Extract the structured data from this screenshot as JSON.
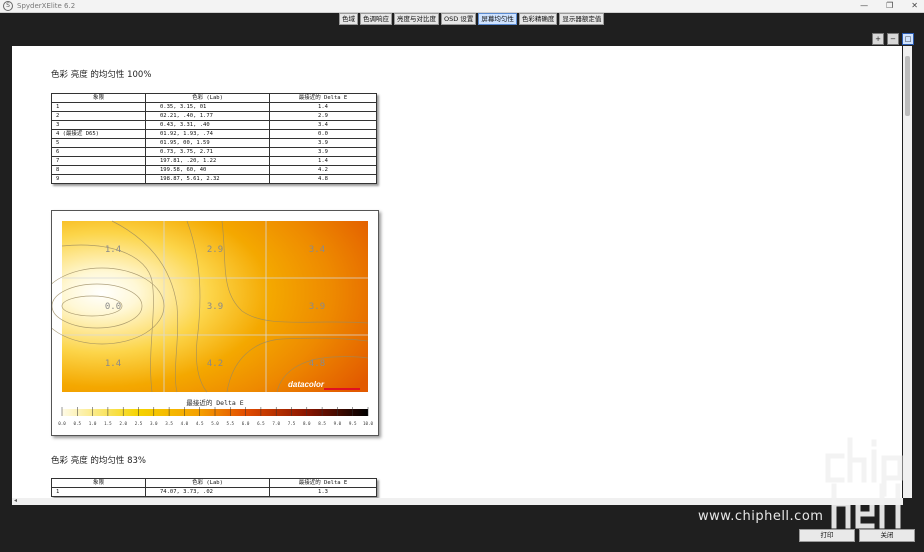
{
  "window": {
    "title": "SpyderXElite 6.2",
    "icon_label": "S"
  },
  "tabs": [
    {
      "label": "色域"
    },
    {
      "label": "色调响应"
    },
    {
      "label": "亮度与对比度"
    },
    {
      "label": "OSD 设置"
    },
    {
      "label": "屏幕均匀性",
      "active": true
    },
    {
      "label": "色彩精确度"
    },
    {
      "label": "显示器额定值"
    }
  ],
  "toolbar": {
    "icons": [
      "zoom-in-icon",
      "zoom-out-icon",
      "zoom-fit-icon"
    ]
  },
  "section1": {
    "title": "色彩 亮度 的均匀性 100%",
    "headers": [
      "象限",
      "色彩 (Lab)",
      "最接近的 Delta E"
    ],
    "rows": [
      [
        "1",
        "0.35,   3.15,    01",
        "1.4"
      ],
      [
        "2",
        "02.21,    .40,   1.77",
        "2.9"
      ],
      [
        "3",
        "0.43,   3.31,    .40",
        "3.4"
      ],
      [
        "4 (最接近 D65)",
        "01.92,   1.93,    .74",
        "0.0"
      ],
      [
        "5",
        "01.95,    00,   1.59",
        "3.9"
      ],
      [
        "6",
        "0.73,   3.75,   2.71",
        "3.9"
      ],
      [
        "7",
        "197.81,    .20,   1.22",
        "1.4"
      ],
      [
        "8",
        "199.58,    60,    40",
        "4.2"
      ],
      [
        "9",
        "198.87,   5.61,   2.32",
        "4.8"
      ]
    ]
  },
  "heatmap": {
    "cell_values": [
      "1.4",
      "2.9",
      "3.4",
      "0.0",
      "3.9",
      "3.9",
      "1.4",
      "4.2",
      "4.8"
    ],
    "brand": "datacolor",
    "legend_title": "最接近的 Delta E",
    "legend_ticks": [
      "0.0",
      "0.5",
      "1.0",
      "1.5",
      "2.0",
      "2.5",
      "3.0",
      "3.5",
      "4.0",
      "4.5",
      "5.0",
      "5.5",
      "6.0",
      "6.5",
      "7.0",
      "7.5",
      "8.0",
      "8.5",
      "9.0",
      "9.5",
      "10.0"
    ],
    "colors": {
      "low": "#fffbe8",
      "mid": "#f5b800",
      "high": "#e24c00",
      "max": "#000000"
    }
  },
  "chart_data": {
    "type": "heatmap",
    "title": "",
    "rows": 3,
    "cols": 3,
    "values": [
      [
        1.4,
        2.9,
        3.4
      ],
      [
        0.0,
        3.9,
        3.9
      ],
      [
        1.4,
        4.2,
        4.8
      ]
    ],
    "colorbar_label": "最接近的 Delta E",
    "colorbar_range": [
      0,
      10
    ]
  },
  "section2": {
    "title": "色彩 亮度 的均匀性 83%",
    "headers": [
      "象限",
      "色彩 (Lab)",
      "最接近的 Delta E"
    ],
    "rows": [
      [
        "1",
        "74.07,   3.73,    .02",
        "1.3"
      ]
    ]
  },
  "buttons": {
    "print": "打印",
    "close": "关闭"
  },
  "watermark": {
    "url": "www.chiphell.com",
    "logo": "chip hell"
  },
  "window_controls": {
    "minimize": "—",
    "restore": "❐",
    "close": "✕"
  }
}
